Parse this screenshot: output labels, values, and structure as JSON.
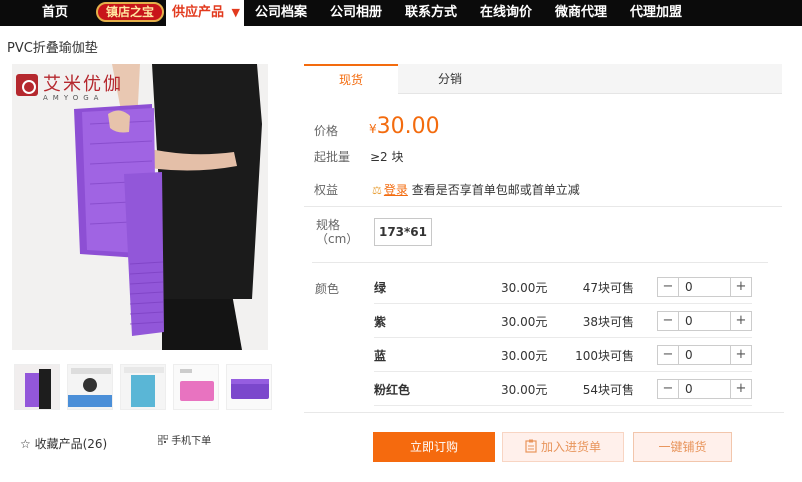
{
  "nav": {
    "items": [
      "首页",
      "公司档案",
      "公司相册",
      "联系方式",
      "在线询价",
      "微商代理",
      "代理加盟"
    ],
    "badge": "镇店之宝",
    "active": "供应产品",
    "active_arrow": "▼"
  },
  "product": {
    "title": "PVC折叠瑜伽垫",
    "logo_text": "艾米优伽",
    "logo_sub": "AMYOGA"
  },
  "tabs": {
    "active": "现货",
    "other": "分销"
  },
  "info": {
    "price_label": "价格",
    "price_symbol": "¥",
    "price": "30.00",
    "moq_label": "起批量",
    "moq_value": "≥2 块",
    "perk_label": "权益",
    "perk_link": "登录",
    "perk_text": "查看是否享首单包邮或首单立减"
  },
  "spec": {
    "label": "规格",
    "label_unit": "（cm）",
    "value": "173*61"
  },
  "color_label": "颜色",
  "skus": [
    {
      "name": "绿",
      "price": "30.00元",
      "stock": "47块可售",
      "qty": "0"
    },
    {
      "name": "紫",
      "price": "30.00元",
      "stock": "38块可售",
      "qty": "0"
    },
    {
      "name": "蓝",
      "price": "30.00元",
      "stock": "100块可售",
      "qty": "0"
    },
    {
      "name": "粉红色",
      "price": "30.00元",
      "stock": "54块可售",
      "qty": "0"
    }
  ],
  "stepper": {
    "minus": "−",
    "plus": "+"
  },
  "actions": {
    "buy": "立即订购",
    "cart": "加入进货单",
    "one_click": "一键铺货"
  },
  "footer": {
    "favorite_star": "☆",
    "favorite": "收藏产品(26)",
    "mobile": "手机下单"
  },
  "colors": {
    "accent": "#f36b0e",
    "nav_bg": "#0b0b0b",
    "mat_purple": "#8b4fd0"
  }
}
